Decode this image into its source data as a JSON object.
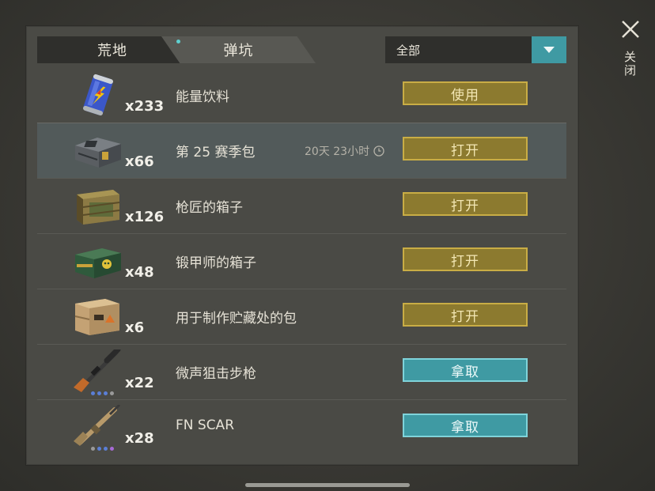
{
  "tabs": [
    {
      "label": "荒地"
    },
    {
      "label": "弹坑"
    }
  ],
  "filter": {
    "selected": "全部"
  },
  "close": {
    "label": "关闭"
  },
  "items": [
    {
      "name": "能量饮料",
      "qty": "x233",
      "action": "使用",
      "icon": "energy-drink-can-icon"
    },
    {
      "name": "第 25 赛季包",
      "qty": "x66",
      "action": "打开",
      "timer": "20天 23小时",
      "icon": "season-pack-crate-icon"
    },
    {
      "name": "枪匠的箱子",
      "qty": "x126",
      "action": "打开",
      "icon": "gunsmith-crate-icon"
    },
    {
      "name": "锻甲师的箱子",
      "qty": "x48",
      "action": "打开",
      "icon": "armorer-crate-icon"
    },
    {
      "name": "用于制作贮藏处的包",
      "qty": "x6",
      "action": "打开",
      "icon": "stash-cardboard-box-icon"
    },
    {
      "name": "微声狙击步枪",
      "qty": "x22",
      "action": "拿取",
      "icon": "silenced-sniper-rifle-icon"
    },
    {
      "name": "FN SCAR",
      "qty": "x28",
      "action": "拿取",
      "icon": "fn-scar-rifle-icon"
    }
  ],
  "colors": {
    "gold_button": "#8c7a2f",
    "teal_button": "#3f9aa3",
    "panel": "#4a4a45"
  }
}
